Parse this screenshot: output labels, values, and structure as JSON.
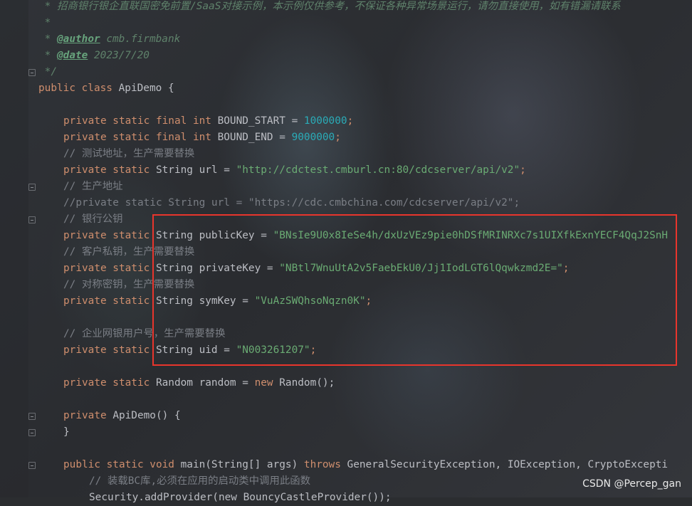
{
  "code": {
    "doc_line_1": " * 招商银行银企直联国密免前置/SaaS对接示例，本示例仅供参考，不保证各种异常场景运行，请勿直接使用，如有错漏请联系",
    "doc_line_2": " *",
    "author_prefix": " * ",
    "author_tag": "@author",
    "author_value": " cmb.firmbank",
    "date_prefix": " * ",
    "date_tag": "@date",
    "date_value": " 2023/7/20",
    "doc_end": " */",
    "class_kw": "public class",
    "class_name": " ApiDemo {",
    "bound_start_kw": "private static final int",
    "bound_start_name": " BOUND_START = ",
    "bound_start_value": "1000000",
    "bound_end_kw": "private static final int",
    "bound_end_name": " BOUND_END = ",
    "bound_end_value": "9000000",
    "semicolon": ";",
    "comment_test_addr": "// 测试地址，生产需要替换",
    "url_kw": "private static",
    "url_type": " String url = ",
    "url_value": "\"http://cdctest.cmburl.cn:80/cdcserver/api/v2\"",
    "comment_prod_addr": "// 生产地址",
    "commented_url": "//private static String url = \"https://cdc.cmbchina.com/cdcserver/api/v2\";",
    "comment_bank_pubkey": "// 银行公钥",
    "pubkey_kw": "private static",
    "pubkey_type": " String publicKey = ",
    "pubkey_value": "\"BNsIe9U0x8IeSe4h/dxUzVEz9pie0hDSfMRINRXc7s1UIXfkExnYECF4QqJ2SnH",
    "comment_private_key": "// 客户私钥，生产需要替换",
    "privkey_kw": "private static",
    "privkey_type": " String privateKey = ",
    "privkey_value": "\"NBtl7WnuUtA2v5FaebEkU0/Jj1IodLGT6lQqwkzmd2E=\"",
    "comment_sym_key": "// 对称密钥，生产需要替换",
    "symkey_kw": "private static",
    "symkey_type": " String symKey = ",
    "symkey_value": "\"VuAzSWQhsoNqzn0K\"",
    "comment_uid": "// 企业网银用户号，生产需要替换",
    "uid_kw": "private static",
    "uid_type": " String uid = ",
    "uid_value": "\"N003261207\"",
    "random_kw": "private static",
    "random_type": " Random random = ",
    "random_new": "new",
    "random_ctor": " Random();",
    "ctor_kw": "private",
    "ctor_sig": " ApiDemo() {",
    "ctor_close": "}",
    "main_kw": "public static void",
    "main_sig": " main(String[] args) ",
    "main_throws": "throws",
    "main_exceptions": " GeneralSecurityException, IOException, CryptoExcepti",
    "comment_load_bc": "// 装载BC库,必须在应用的启动类中调用此函数",
    "partial_line": "Security.addProvider(new BouncyCastleProvider());"
  },
  "watermark": "CSDN @Percep_gan",
  "colors": {
    "keyword": "#cf8e6d",
    "string": "#6aab73",
    "number": "#2aacb8",
    "comment": "#7a7e85",
    "highlight_border": "#e8352c"
  }
}
